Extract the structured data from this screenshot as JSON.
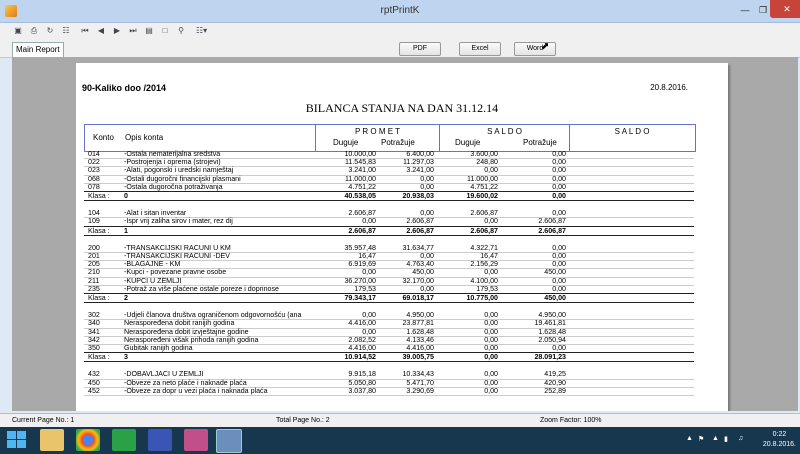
{
  "window": {
    "title": "rptPrintK"
  },
  "tabs": {
    "main": "Main Report"
  },
  "export": {
    "pdf": "PDF",
    "excel": "Excel",
    "word": "Word"
  },
  "report": {
    "company": "90-Kaliko doo  /2014",
    "date": "20.8.2016.",
    "title": "BILANCA STANJA NA DAN  31.12.14",
    "headers": {
      "konto": "Konto",
      "opis": "Opis konta",
      "promet": "P R O M E T",
      "saldo1": "S A L D O",
      "saldo2": "S A L D O",
      "duguje": "Duguje",
      "potrazuje": "Potražuje"
    },
    "rows": [
      {
        "konto": "014",
        "opis": "-Ostala nematerijalna  sredstva",
        "d": "10.000,00",
        "p": "6.400,00",
        "sd": "3.600,00",
        "sp": "0,00"
      },
      {
        "konto": "022",
        "opis": "-Postrojenja i oprema (strojevi)",
        "d": "11.545,83",
        "p": "11.297,03",
        "sd": "248,80",
        "sp": "0,00"
      },
      {
        "konto": "023",
        "opis": "-Alati, pogonski i uredski namještaj",
        "d": "3.241,00",
        "p": "3.241,00",
        "sd": "0,00",
        "sp": "0,00"
      },
      {
        "konto": "068",
        "opis": "-Ostali dugoročni financijski plasmani",
        "d": "11.000,00",
        "p": "0,00",
        "sd": "11.000,00",
        "sp": "0,00"
      },
      {
        "konto": "078",
        "opis": "-Ostala dugoročna potraživanja",
        "d": "4.751,22",
        "p": "0,00",
        "sd": "4.751,22",
        "sp": "0,00"
      },
      {
        "klasa": "Klasa :",
        "konto": "0",
        "d": "40.538,05",
        "p": "20.938,03",
        "sd": "19.600,02",
        "sp": "0,00"
      },
      {
        "konto": "104",
        "opis": "-Alat i sitan inventar",
        "d": "2.606,87",
        "p": "0,00",
        "sd": "2.606,87",
        "sp": "0,00"
      },
      {
        "konto": "109",
        "opis": "-Ispr vrij zaliha sirov i mater, rez dij",
        "d": "0,00",
        "p": "2.606,87",
        "sd": "0,00",
        "sp": "2.606,87"
      },
      {
        "klasa": "Klasa :",
        "konto": "1",
        "d": "2.606,87",
        "p": "2.606,87",
        "sd": "2.606,87",
        "sp": "2.606,87"
      },
      {
        "konto": "200",
        "opis": "-TRANSAKCIJSKI RACUNI U KM",
        "d": "35.957,48",
        "p": "31.634,77",
        "sd": "4.322,71",
        "sp": "0,00"
      },
      {
        "konto": "201",
        "opis": "-TRANSAKCIJSKI RACUNI -DEV",
        "d": "16,47",
        "p": "0,00",
        "sd": "16,47",
        "sp": "0,00"
      },
      {
        "konto": "205",
        "opis": "-BLAGAJNE - KM",
        "d": "6.919,69",
        "p": "4.763,40",
        "sd": "2.156,29",
        "sp": "0,00"
      },
      {
        "konto": "210",
        "opis": "-Kupci - povezane pravne osobe",
        "d": "0,00",
        "p": "450,00",
        "sd": "0,00",
        "sp": "450,00"
      },
      {
        "konto": "211",
        "opis": "-KUPCI U ZEMLJI",
        "d": "36.270,00",
        "p": "32.170,00",
        "sd": "4.100,00",
        "sp": "0,00"
      },
      {
        "konto": "235",
        "opis": "-Potraž za više plaćene ostale poreze i doprinose",
        "d": "179,53",
        "p": "0,00",
        "sd": "179,53",
        "sp": "0,00"
      },
      {
        "klasa": "Klasa :",
        "konto": "2",
        "d": "79.343,17",
        "p": "69.018,17",
        "sd": "10.775,00",
        "sp": "450,00"
      },
      {
        "konto": "302",
        "opis": "-Udjeli članova društva ograničenom odgovornošću (ana",
        "d": "0,00",
        "p": "4.950,00",
        "sd": "0,00",
        "sp": "4.950,00"
      },
      {
        "konto": "340",
        "opis": "Neraspoređena dobit ranijih godina",
        "d": "4.416,00",
        "p": "23.877,81",
        "sd": "0,00",
        "sp": "19.461,81"
      },
      {
        "konto": "341",
        "opis": "Neraspoređena dobit izvještajne godine",
        "d": "0,00",
        "p": "1.628,48",
        "sd": "0,00",
        "sp": "1.628,48"
      },
      {
        "konto": "342",
        "opis": "Neraspoređeni višak prihoda ranijih godina",
        "d": "2.082,52",
        "p": "4.133,46",
        "sd": "0,00",
        "sp": "2.050,94"
      },
      {
        "konto": "350",
        "opis": "Gubitak ranijih godina",
        "d": "4.416,00",
        "p": "4.416,00",
        "sd": "0,00",
        "sp": "0,00"
      },
      {
        "klasa": "Klasa :",
        "konto": "3",
        "d": "10.914,52",
        "p": "39.005,75",
        "sd": "0,00",
        "sp": "28.091,23"
      },
      {
        "konto": "432",
        "opis": "-DOBAVLJACI U ZEMLJI",
        "d": "9.915,18",
        "p": "10.334,43",
        "sd": "0,00",
        "sp": "419,25"
      },
      {
        "konto": "450",
        "opis": "-Obveze za neto plaće i naknade plaća",
        "d": "5.050,80",
        "p": "5.471,70",
        "sd": "0,00",
        "sp": "420,90"
      },
      {
        "konto": "452",
        "opis": "-Obveze za dopr u vezi plaća i naknada plaća",
        "d": "3.037,80",
        "p": "3.290,69",
        "sd": "0,00",
        "sp": "252,89"
      }
    ]
  },
  "status": {
    "current_page": "Current Page No.: 1",
    "total_page": "Total Page No.: 2",
    "zoom": "Zoom Factor: 100%"
  },
  "taskbar": {
    "time": "0:22",
    "date": "20.8.2016."
  }
}
